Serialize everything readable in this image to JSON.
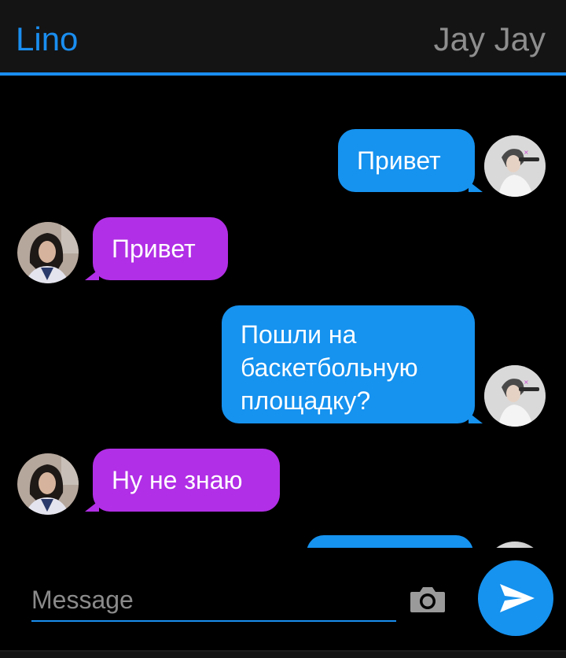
{
  "header": {
    "left_name": "Lino",
    "right_name": "Jay Jay"
  },
  "messages": [
    {
      "side": "out",
      "text": "Привет",
      "avatar": "boy-avatar"
    },
    {
      "side": "in",
      "text": "Привет",
      "avatar": "girl-avatar"
    },
    {
      "side": "out",
      "text": "Пошли на\nбаскетбольную\nплощадку?",
      "avatar": "boy-avatar"
    },
    {
      "side": "in",
      "text": "Ну не знаю",
      "avatar": "girl-avatar"
    }
  ],
  "composer": {
    "placeholder": "Message",
    "camera_icon": "camera-icon",
    "send_icon": "send-icon"
  },
  "colors": {
    "accent": "#1a8ef0",
    "outgoing_bubble": "#1692ef",
    "incoming_bubble": "#b12fe6",
    "background": "#000000",
    "header": "#141414"
  }
}
